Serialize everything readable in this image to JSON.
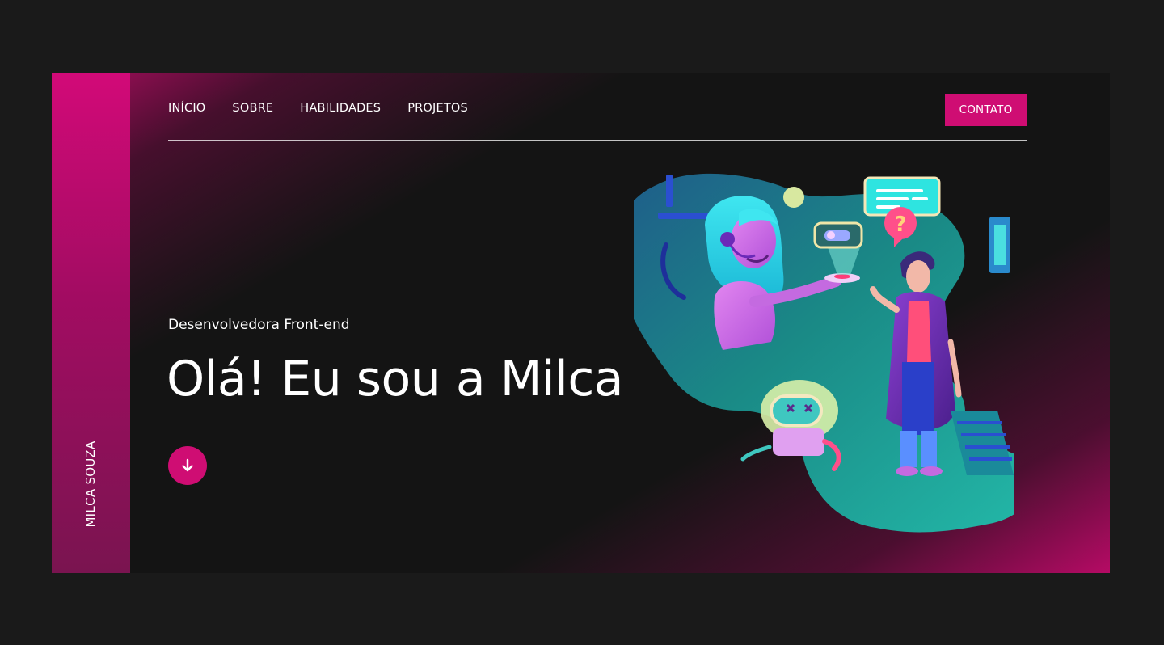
{
  "sidebar": {
    "name": "MILCA SOUZA"
  },
  "nav": {
    "items": [
      "INÍCIO",
      "SOBRE",
      "HABILIDADES",
      "PROJETOS"
    ],
    "contact_label": "CONTATO"
  },
  "hero": {
    "subtitle": "Desenvolvedora Front-end",
    "title": "Olá! Eu sou a Milca",
    "scroll_icon": "arrow-down-icon"
  },
  "illustration": {
    "description_icon": "support-agent-illustration",
    "question_mark": "?"
  },
  "colors": {
    "accent": "#cf0d73",
    "background": "#141414",
    "page": "#1a1a1a"
  }
}
